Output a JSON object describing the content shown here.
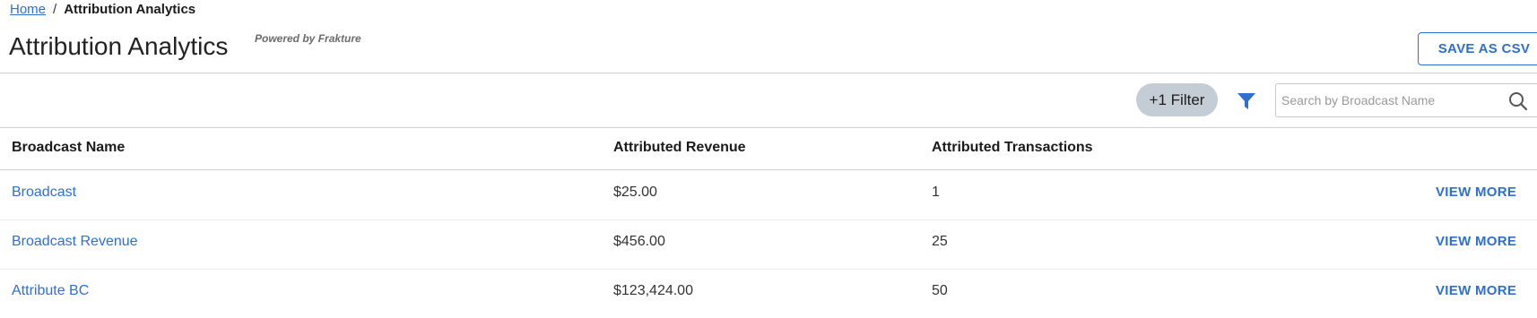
{
  "breadcrumb": {
    "home": "Home",
    "separator": "/",
    "current": "Attribution Analytics"
  },
  "page": {
    "title": "Attribution Analytics",
    "powered_by": "Powered by Frakture"
  },
  "toolbar": {
    "save_csv_label": "SAVE AS CSV",
    "filter_chip_label": "+1 Filter",
    "filter_icon": "funnel-icon",
    "search_placeholder": "Search by Broadcast Name",
    "search_value": "",
    "search_icon": "search-icon",
    "accent_color": "#2f6fd1"
  },
  "table": {
    "columns": [
      "Broadcast Name",
      "Attributed Revenue",
      "Attributed Transactions"
    ],
    "rows": [
      {
        "name": "Broadcast",
        "revenue": "$25.00",
        "transactions": "1",
        "action": "VIEW MORE"
      },
      {
        "name": "Broadcast Revenue",
        "revenue": "$456.00",
        "transactions": "25",
        "action": "VIEW MORE"
      },
      {
        "name": "Attribute BC",
        "revenue": "$123,424.00",
        "transactions": "50",
        "action": "VIEW MORE"
      }
    ]
  }
}
